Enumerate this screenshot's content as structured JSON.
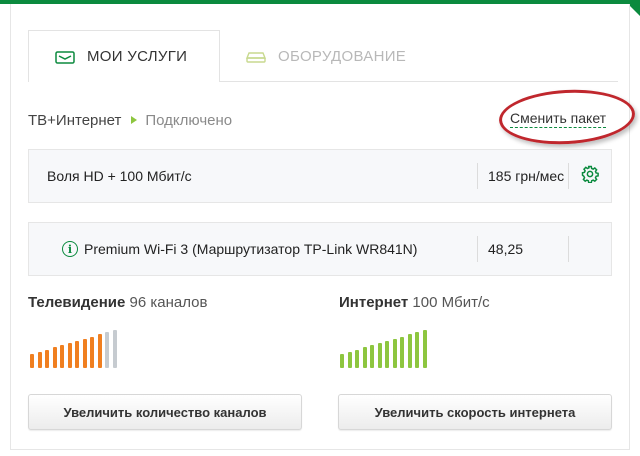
{
  "tabs": [
    {
      "label": "МОИ УСЛУГИ",
      "icon": "tv-services-icon",
      "active": true
    },
    {
      "label": "ОБОРУДОВАНИЕ",
      "icon": "router-equipment-icon",
      "active": false
    }
  ],
  "status": {
    "service": "ТВ+Интернет",
    "state": "Подключено",
    "change_link": "Сменить пакет"
  },
  "packages": [
    {
      "name": "Воля HD + 100 Мбит/с",
      "price": "185 грн/мес",
      "action_icon": "gear-icon"
    },
    {
      "name": "Premium Wi-Fi 3 (Маршрутизатор TP-Link WR841N)",
      "price": "48,25",
      "info_icon": "info-icon"
    }
  ],
  "tv": {
    "title": "Телевидение",
    "detail": "96 каналов",
    "level": 0.8,
    "button": "Увеличить количество каналов"
  },
  "internet": {
    "title": "Интернет",
    "detail": "100 Мбит/с",
    "level": 1.0,
    "button": "Увеличить скорость интернета"
  },
  "colors": {
    "brand": "#0b8a3e",
    "tv_bar": "#f07f20",
    "tv_bar_empty": "#c6cbd0",
    "net_bar": "#8dc63f",
    "highlight": "#c0272d"
  }
}
